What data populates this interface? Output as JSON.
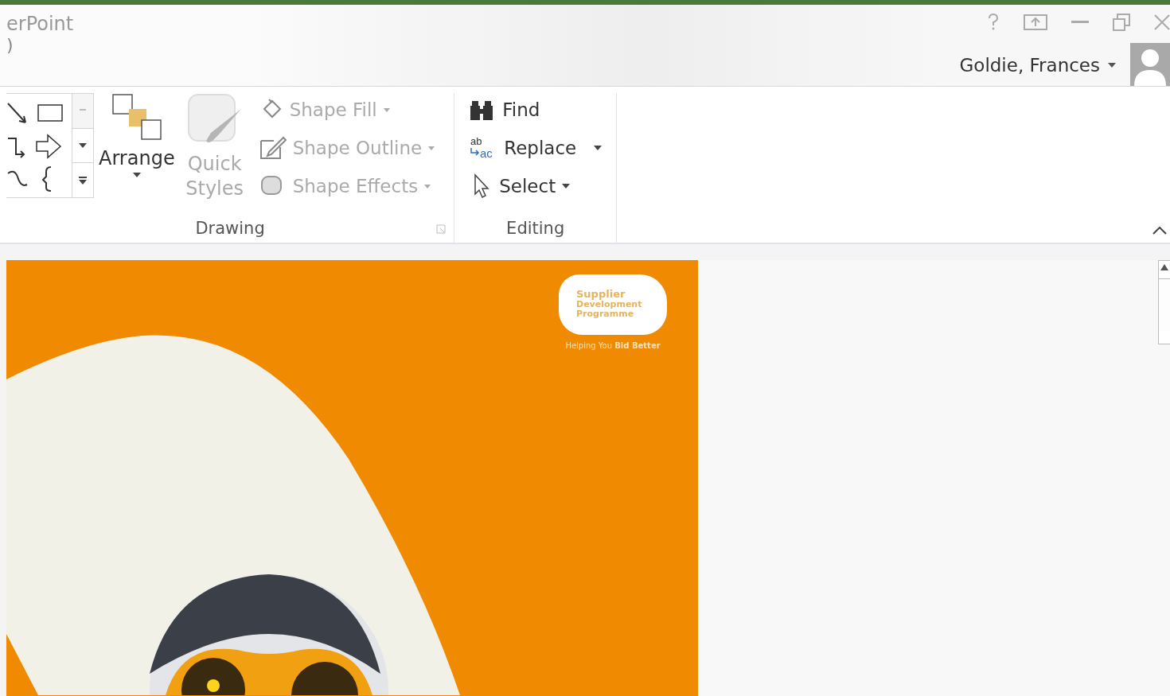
{
  "window": {
    "title": "erPoint",
    "subtitle": ")"
  },
  "account": {
    "user_name": "Goldie, Frances"
  },
  "ribbon": {
    "drawing": {
      "label": "Drawing",
      "arrange": {
        "label": "Arrange",
        "disabled": false
      },
      "quick_styles": {
        "label": "Quick Styles",
        "disabled": true
      },
      "commands": [
        {
          "label": "Shape Fill",
          "kind": "fill",
          "disabled": true
        },
        {
          "label": "Shape Outline",
          "kind": "outline",
          "disabled": true
        },
        {
          "label": "Shape Effects",
          "kind": "effects",
          "disabled": true
        }
      ]
    },
    "editing": {
      "label": "Editing",
      "commands": [
        {
          "label": "Find",
          "kind": "find",
          "disabled": false
        },
        {
          "label": "Replace",
          "kind": "replace",
          "disabled": false,
          "icon_text": [
            "ab",
            "ac"
          ]
        },
        {
          "label": "Select",
          "kind": "select",
          "disabled": false
        }
      ]
    }
  },
  "slide": {
    "logo_lines": [
      "Supplier",
      "Development",
      "Programme"
    ],
    "tagline": "Helping You **Bid Better**"
  }
}
